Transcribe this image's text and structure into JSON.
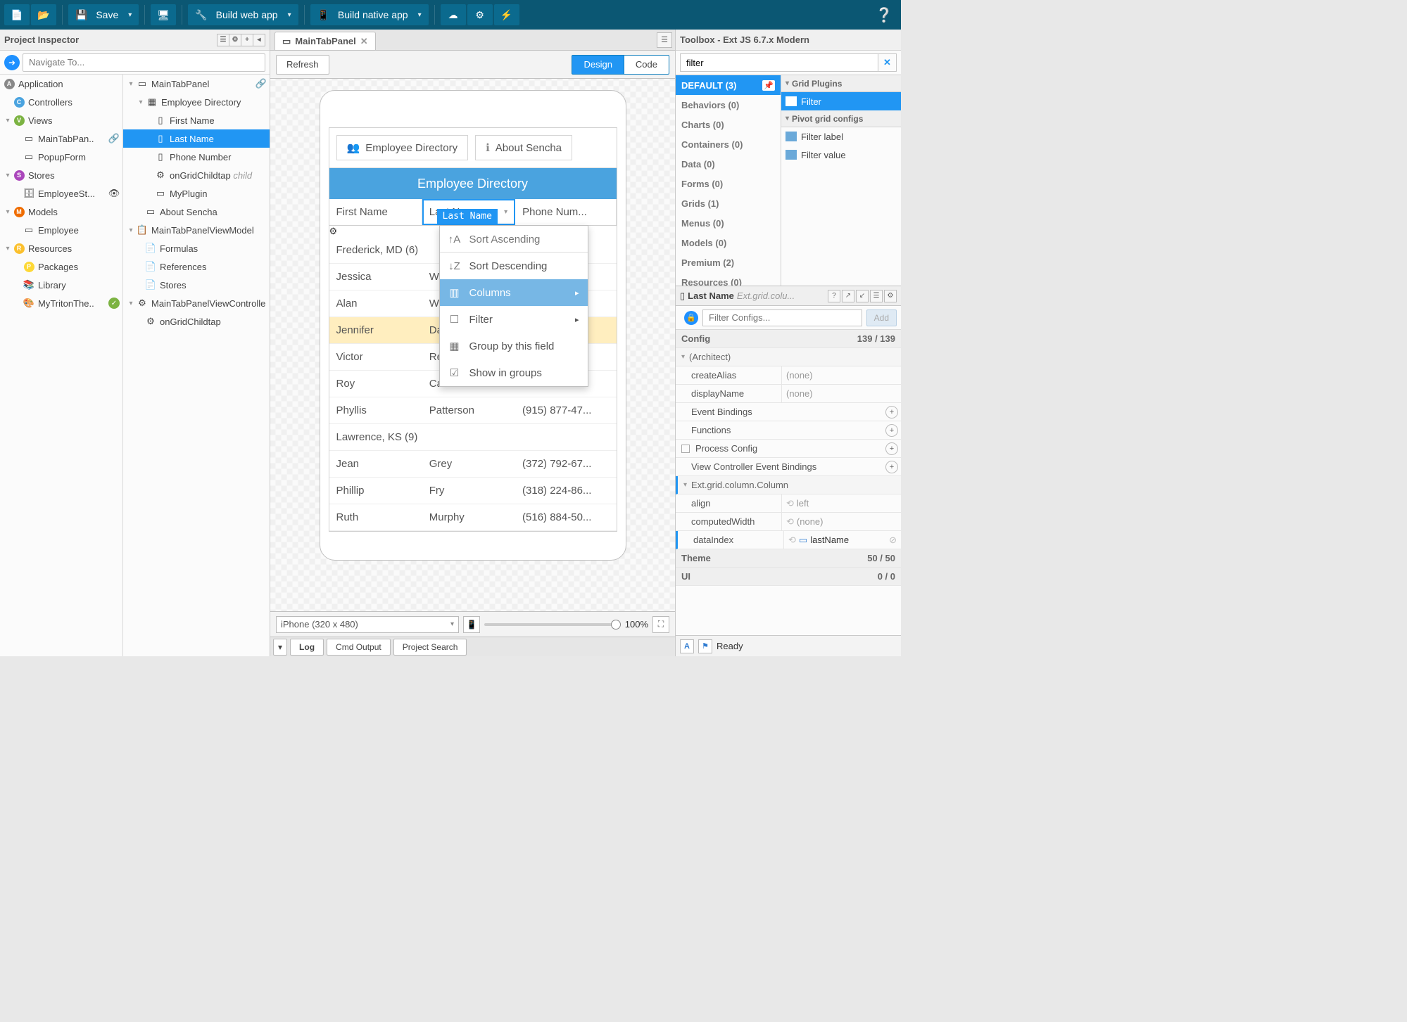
{
  "toolbar": {
    "save": "Save",
    "build_web": "Build web app",
    "build_native": "Build native app"
  },
  "inspector": {
    "title": "Project Inspector",
    "nav_placeholder": "Navigate To...",
    "tree1": {
      "application": "Application",
      "controllers": "Controllers",
      "views": "Views",
      "maintabpanel": "MainTabPan..",
      "popupform": "PopupForm",
      "stores": "Stores",
      "employeest": "EmployeeSt...",
      "models": "Models",
      "employee": "Employee",
      "resources": "Resources",
      "packages": "Packages",
      "library": "Library",
      "theme": "MyTritonThe.."
    },
    "tree2": {
      "maintabpanel": "MainTabPanel",
      "empdir": "Employee Directory",
      "firstname": "First Name",
      "lastname": "Last Name",
      "phone": "Phone Number",
      "ongridchildtap": "onGridChildtap",
      "ongridchildtap_hint": "child",
      "myplugin": "MyPlugin",
      "aboutsencha": "About Sencha",
      "viewmodel": "MainTabPanelViewModel",
      "formulas": "Formulas",
      "references": "References",
      "stores": "Stores",
      "viewcontroller": "MainTabPanelViewControlle",
      "ongridchildtap2": "onGridChildtap"
    }
  },
  "center": {
    "tab": "MainTabPanel",
    "refresh": "Refresh",
    "design": "Design",
    "code": "Code",
    "device": "iPhone (320 x 480)",
    "zoom": "100%",
    "bottom": {
      "log": "Log",
      "cmd": "Cmd Output",
      "search": "Project Search"
    }
  },
  "app": {
    "tab_emp": "Employee Directory",
    "tab_about": "About Sencha",
    "title": "Employee Directory",
    "cols": {
      "first": "First Name",
      "last": "Last Name",
      "phone": "Phone Num..."
    },
    "tooltip": "Last Name",
    "menu": {
      "asc": "Sort Ascending",
      "desc": "Sort Descending",
      "columns": "Columns",
      "filter": "Filter",
      "group": "Group by this field",
      "show": "Show in groups"
    },
    "rows": [
      {
        "group": "Frederick, MD (6)"
      },
      {
        "f": "Jessica",
        "l": "Wrig",
        "p": ""
      },
      {
        "f": "Alan",
        "l": "Was",
        "p": ""
      },
      {
        "f": "Jennifer",
        "l": "Day",
        "p": "",
        "sel": true
      },
      {
        "f": "Victor",
        "l": "Reid",
        "p": ""
      },
      {
        "f": "Roy",
        "l": "Carr",
        "p": ""
      },
      {
        "f": "Phyllis",
        "l": "Patterson",
        "p": "(915) 877-47..."
      },
      {
        "group": "Lawrence, KS (9)"
      },
      {
        "f": "Jean",
        "l": "Grey",
        "p": "(372) 792-67..."
      },
      {
        "f": "Phillip",
        "l": "Fry",
        "p": "(318) 224-86..."
      },
      {
        "f": "Ruth",
        "l": "Murphy",
        "p": "(516) 884-50..."
      }
    ]
  },
  "toolbox": {
    "title": "Toolbox - Ext JS 6.7.x Modern",
    "filter_value": "filter",
    "cats": [
      "DEFAULT (3)",
      "Behaviors (0)",
      "Charts (0)",
      "Containers (0)",
      "Data (0)",
      "Forms (0)",
      "Grids (1)",
      "Menus (0)",
      "Models (0)",
      "Premium (2)",
      "Resources (0)"
    ],
    "groups": {
      "grid_plugins": "Grid Plugins",
      "pivot": "Pivot grid configs"
    },
    "items": {
      "filter": "Filter",
      "filter_label": "Filter label",
      "filter_value": "Filter value"
    }
  },
  "config": {
    "title": "Last Name",
    "type": "Ext.grid.colu...",
    "filter_placeholder": "Filter Configs...",
    "add": "Add",
    "section": "Config",
    "count": "139 / 139",
    "architect": "(Architect)",
    "createAlias": {
      "k": "createAlias",
      "v": "(none)"
    },
    "displayName": {
      "k": "displayName",
      "v": "(none)"
    },
    "eventBindings": "Event Bindings",
    "functions": "Functions",
    "processConfig": "Process Config",
    "vcBindings": "View Controller Event Bindings",
    "column": "Ext.grid.column.Column",
    "align": {
      "k": "align",
      "v": "left"
    },
    "computedWidth": {
      "k": "computedWidth",
      "v": "(none)"
    },
    "dataIndex": {
      "k": "dataIndex",
      "v": "lastName"
    },
    "theme": {
      "label": "Theme",
      "count": "50 / 50"
    },
    "ui": {
      "label": "UI",
      "count": "0 / 0"
    }
  },
  "status": "Ready"
}
